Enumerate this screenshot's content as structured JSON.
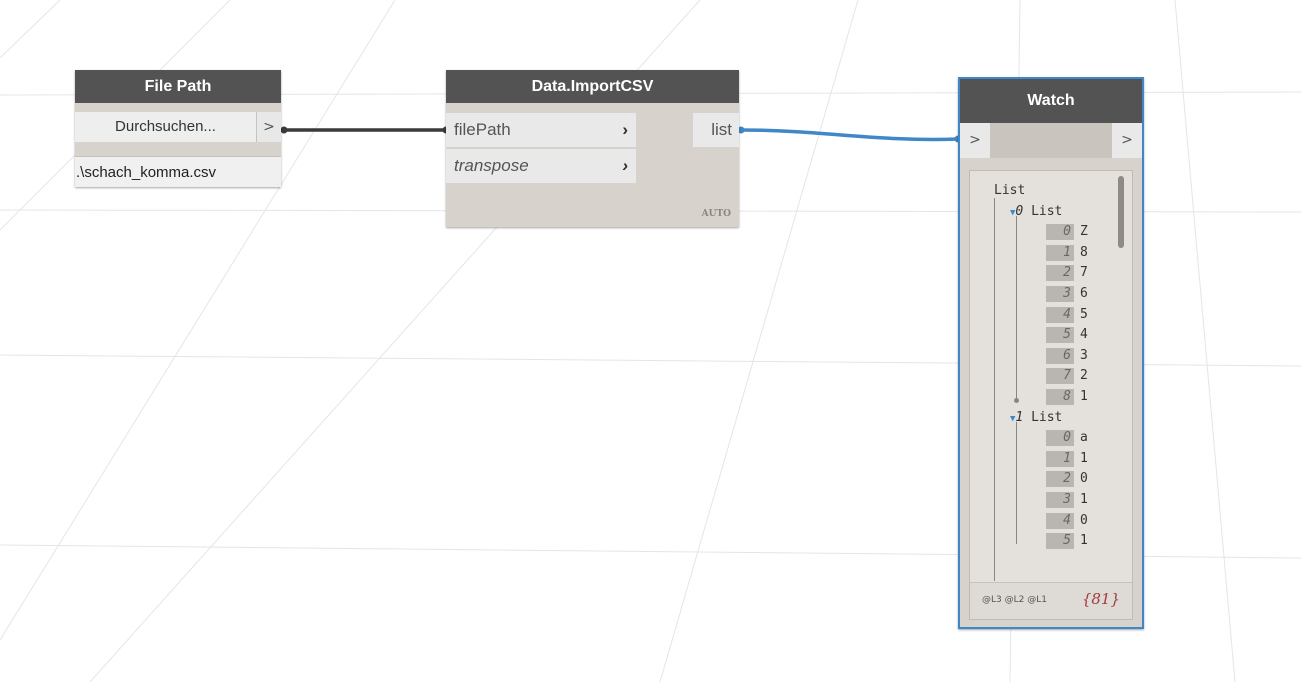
{
  "nodes": {
    "file_path": {
      "title": "File Path",
      "browse_label": "Durchsuchen...",
      "out_port": ">",
      "path_value": ".\\schach_komma.csv"
    },
    "import_csv": {
      "title": "Data.ImportCSV",
      "inputs": [
        {
          "label": "filePath",
          "chevron": "›"
        },
        {
          "label": "transpose",
          "chevron": "›"
        }
      ],
      "output": "list",
      "lacing": "AUTO"
    },
    "watch": {
      "title": "Watch",
      "in_port": ">",
      "out_port": ">",
      "tree": {
        "root": "List",
        "sublists": [
          {
            "index": "0",
            "label": "List",
            "items": [
              {
                "i": "0",
                "v": "Z"
              },
              {
                "i": "1",
                "v": "8"
              },
              {
                "i": "2",
                "v": "7"
              },
              {
                "i": "3",
                "v": "6"
              },
              {
                "i": "4",
                "v": "5"
              },
              {
                "i": "5",
                "v": "4"
              },
              {
                "i": "6",
                "v": "3"
              },
              {
                "i": "7",
                "v": "2"
              },
              {
                "i": "8",
                "v": "1"
              }
            ]
          },
          {
            "index": "1",
            "label": "List",
            "items": [
              {
                "i": "0",
                "v": "a"
              },
              {
                "i": "1",
                "v": "1"
              },
              {
                "i": "2",
                "v": "0"
              },
              {
                "i": "3",
                "v": "1"
              },
              {
                "i": "4",
                "v": "0"
              },
              {
                "i": "5",
                "v": "1"
              }
            ]
          }
        ]
      },
      "levels": "@L3 @L2 @L1",
      "count": "{81}"
    }
  },
  "colors": {
    "node_header": "#535353",
    "node_body": "#d7d2cc",
    "selection": "#3f87c6",
    "wire_dark": "#3a3a3a",
    "wire_blue": "#3f87c6"
  }
}
